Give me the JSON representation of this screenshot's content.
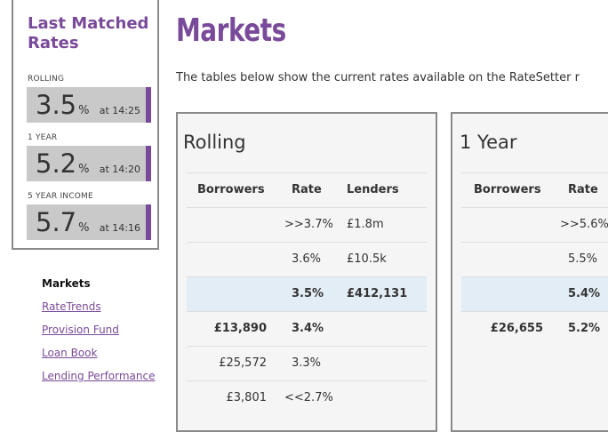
{
  "last_matched": {
    "title": "Last Matched Rates",
    "items": [
      {
        "label": "ROLLING",
        "rate": "3.5",
        "unit": "%",
        "time": "at 14:25"
      },
      {
        "label": "1 YEAR",
        "rate": "5.2",
        "unit": "%",
        "time": "at 14:20"
      },
      {
        "label": "5 YEAR INCOME",
        "rate": "5.7",
        "unit": "%",
        "time": "at 14:16"
      }
    ]
  },
  "nav": {
    "items": [
      {
        "label": "Markets",
        "active": true
      },
      {
        "label": "RateTrends",
        "active": false
      },
      {
        "label": "Provision Fund",
        "active": false
      },
      {
        "label": "Loan Book",
        "active": false
      },
      {
        "label": "Lending Performance",
        "active": false
      }
    ]
  },
  "page": {
    "title": "Markets",
    "intro": "The tables below show the current rates available on the RateSetter r"
  },
  "markets": [
    {
      "title": "Rolling",
      "headers": {
        "borrowers": "Borrowers",
        "rate": "Rate",
        "lenders": "Lenders"
      },
      "rows": [
        {
          "borrowers": "",
          "rate": ">>3.7%",
          "lenders": "£1.8m",
          "highlight": false,
          "bold": false
        },
        {
          "borrowers": "",
          "rate": "3.6%",
          "lenders": "£10.5k",
          "highlight": false,
          "bold": false
        },
        {
          "borrowers": "",
          "rate": "3.5%",
          "lenders": "£412,131",
          "highlight": true,
          "bold": true
        },
        {
          "borrowers": "£13,890",
          "rate": "3.4%",
          "lenders": "",
          "highlight": false,
          "bold": true
        },
        {
          "borrowers": "£25,572",
          "rate": "3.3%",
          "lenders": "",
          "highlight": false,
          "bold": false
        },
        {
          "borrowers": "£3,801",
          "rate": "<<2.7%",
          "lenders": "",
          "highlight": false,
          "bold": false
        }
      ]
    },
    {
      "title": "1 Year",
      "headers": {
        "borrowers": "Borrowers",
        "rate": "Rate"
      },
      "rows": [
        {
          "borrowers": "",
          "rate": ">>5.6%",
          "highlight": false,
          "bold": false
        },
        {
          "borrowers": "",
          "rate": "5.5%",
          "highlight": false,
          "bold": false
        },
        {
          "borrowers": "",
          "rate": "5.4%",
          "highlight": true,
          "bold": true
        },
        {
          "borrowers": "£26,655",
          "rate": "5.2%",
          "highlight": false,
          "bold": true
        }
      ]
    }
  ]
}
